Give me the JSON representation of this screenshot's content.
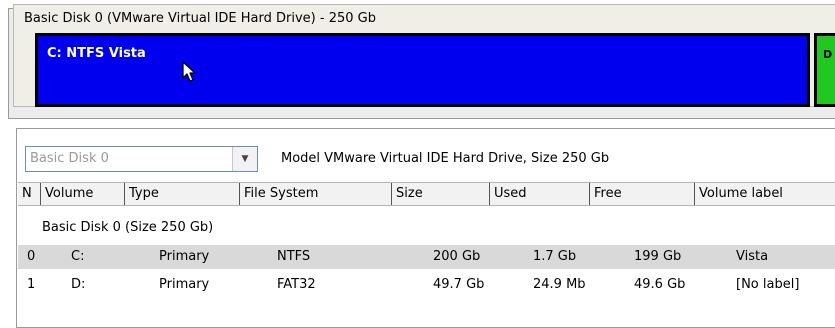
{
  "disk_map": {
    "title": "Basic Disk 0 (VMware Virtual IDE Hard Drive) - 250 Gb",
    "partitions": [
      {
        "label": "C: NTFS Vista",
        "color": "#0000ee"
      },
      {
        "label": "D",
        "color": "#22c822"
      }
    ]
  },
  "volume_list": {
    "disk_select": {
      "value": "Basic Disk 0"
    },
    "model_info": "Model VMware Virtual IDE Hard Drive, Size 250 Gb",
    "columns": [
      "N",
      "Volume",
      "Type",
      "File System",
      "Size",
      "Used",
      "Free",
      "Volume label"
    ],
    "group": "Basic Disk 0 (Size 250 Gb)",
    "rows": [
      {
        "n": "0",
        "volume": "C:",
        "type": "Primary",
        "fs": "NTFS",
        "size": "200 Gb",
        "used": "1.7 Gb",
        "free": "199 Gb",
        "label": "Vista",
        "selected": true
      },
      {
        "n": "1",
        "volume": "D:",
        "type": "Primary",
        "fs": "FAT32",
        "size": "49.7 Gb",
        "used": "24.9 Mb",
        "free": "49.6 Gb",
        "label": "[No label]",
        "selected": false
      }
    ]
  },
  "icons": {
    "cursor": "mouse-pointer-icon",
    "dropdown": "chevron-down-icon"
  },
  "colors": {
    "selected_row": "#d9d9d9",
    "partition_primary": "#0000ee",
    "partition_secondary": "#22c822"
  }
}
